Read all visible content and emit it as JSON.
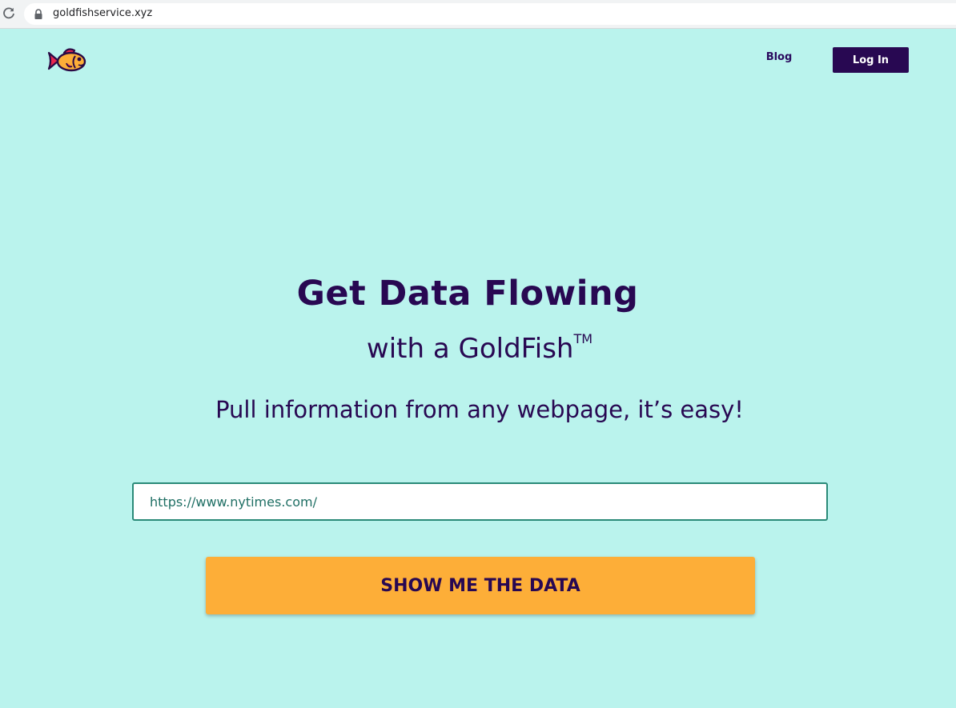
{
  "browser": {
    "url": "goldfishservice.xyz"
  },
  "nav": {
    "blog_label": "Blog",
    "login_label": "Log In"
  },
  "hero": {
    "title": "Get Data Flowing",
    "subtitle": "with a GoldFish",
    "trademark": "TM",
    "tagline": "Pull information from any webpage, it’s easy!"
  },
  "form": {
    "url_value": "https://www.nytimes.com/",
    "submit_label": "SHOW ME THE DATA"
  },
  "colors": {
    "page_background": "#baf3ed",
    "brand_dark": "#280852",
    "accent_orange": "#fdae38",
    "input_border": "#2a8a78"
  },
  "icons": {
    "reload": "reload-icon",
    "lock": "lock-icon",
    "logo": "goldfish-logo-icon"
  }
}
